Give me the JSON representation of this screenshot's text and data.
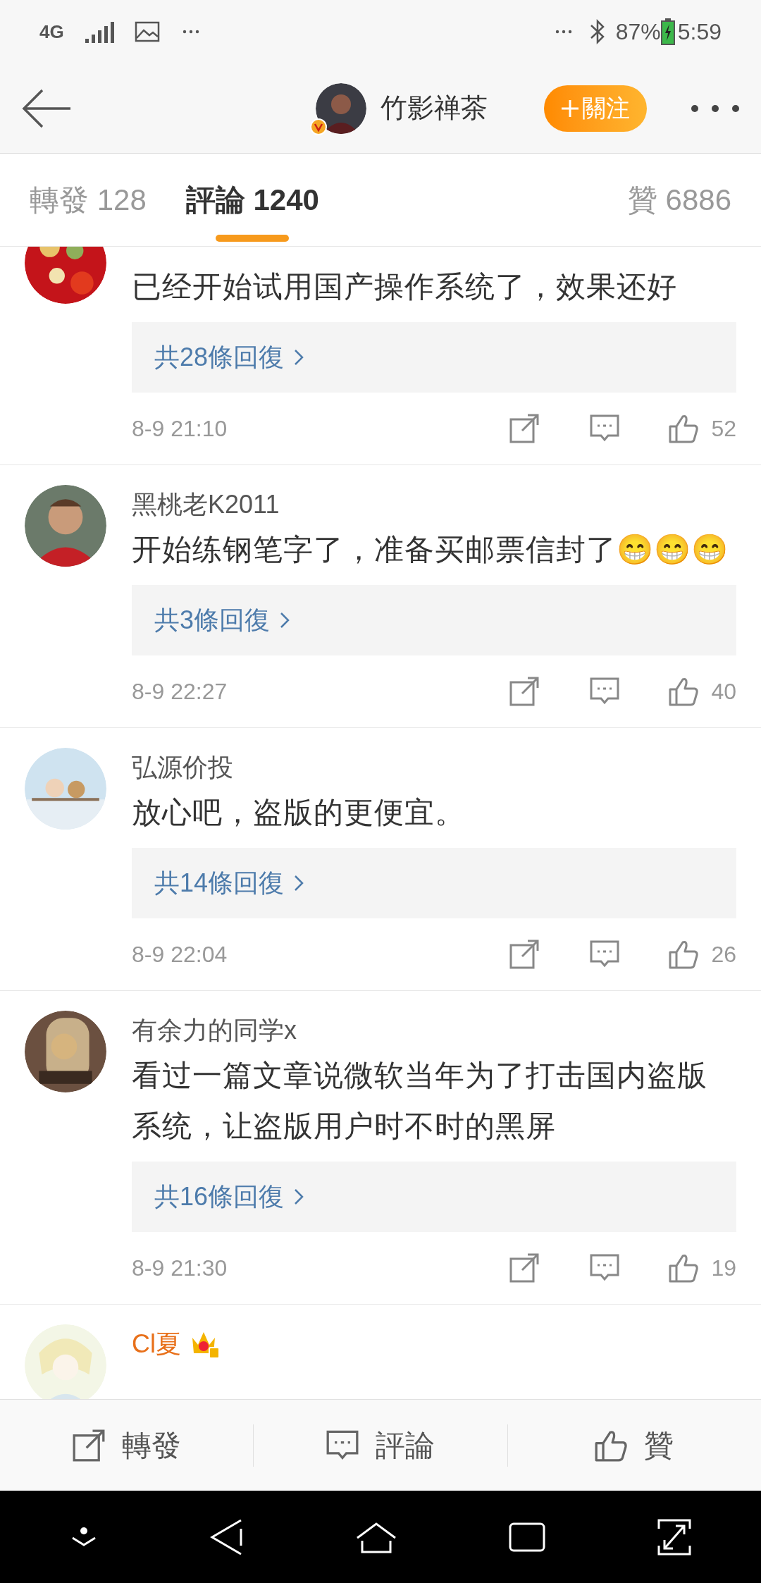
{
  "status_bar": {
    "network": "4G",
    "battery": "87%",
    "time": "5:59"
  },
  "header": {
    "user_name": "竹影禅茶",
    "verified": true,
    "follow_button": "關注"
  },
  "tabs": [
    {
      "label": "轉發",
      "count": "128",
      "selected": false
    },
    {
      "label": "評論",
      "count": "1240",
      "selected": true
    },
    {
      "label": "贊",
      "count": "6886",
      "selected": false
    }
  ],
  "comments": [
    {
      "text": "已经开始试用国产操作系统了，效果还好",
      "replies": "共28條回復",
      "time": "8-9 21:10",
      "likes": "52",
      "vip": false
    },
    {
      "name": "黑桃老K2011",
      "text": "开始练钢笔字了，准备买邮票信封了😁😁😁",
      "replies": "共3條回復",
      "time": "8-9 22:27",
      "likes": "40",
      "vip": false
    },
    {
      "name": "弘源价投",
      "text": "放心吧，盗版的更便宜。",
      "replies": "共14條回復",
      "time": "8-9 22:04",
      "likes": "26",
      "vip": false
    },
    {
      "name": "有余力的同学x",
      "text": "看过一篇文章说微软当年为了打击国内盗版系统，让盗版用户时不时的黑屏",
      "replies": "共16條回復",
      "time": "8-9 21:30",
      "likes": "19",
      "vip": false
    },
    {
      "name": "Cl夏",
      "vip": true
    }
  ],
  "action_bar": [
    {
      "kind": "repost",
      "label": "轉發"
    },
    {
      "kind": "comment",
      "label": "評論"
    },
    {
      "kind": "like",
      "label": "贊"
    }
  ]
}
